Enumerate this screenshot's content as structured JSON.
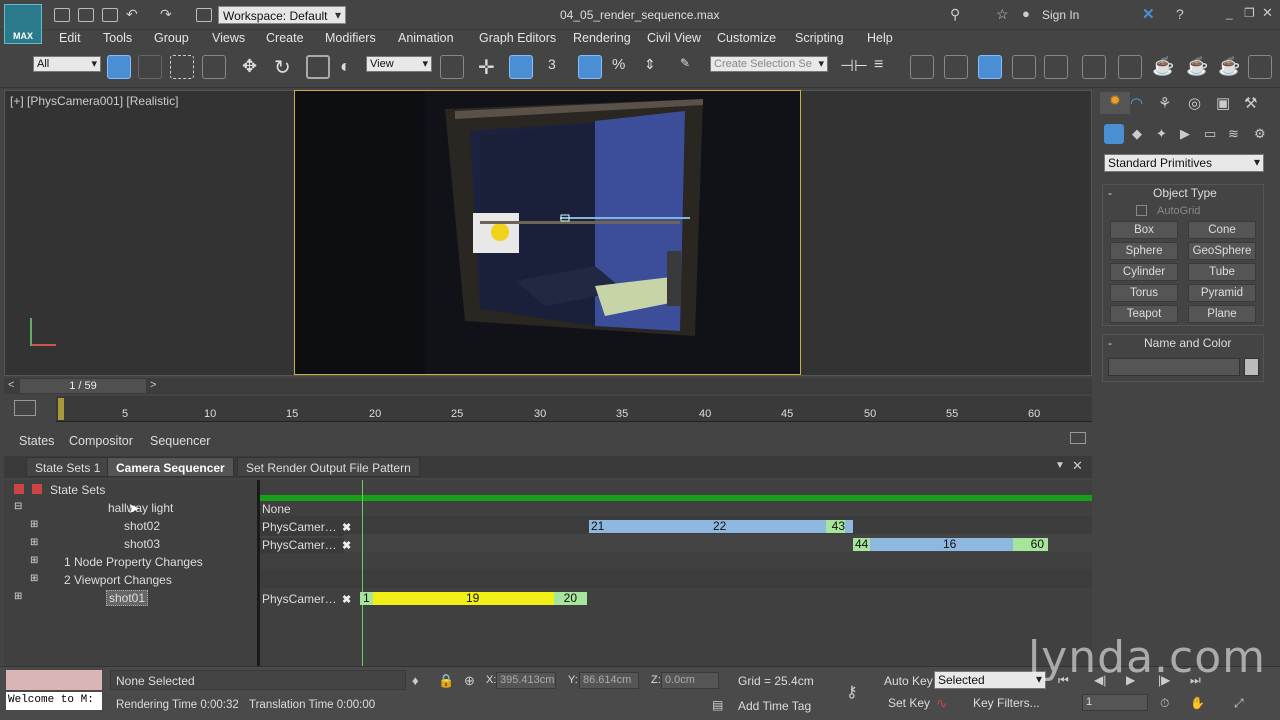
{
  "app": {
    "logo_label": "MAX",
    "workspace": "Workspace: Default",
    "file_title": "04_05_render_sequence.max",
    "sign_in": "Sign In"
  },
  "menu": [
    "Edit",
    "Tools",
    "Group",
    "Views",
    "Create",
    "Modifiers",
    "Animation",
    "Graph Editors",
    "Rendering",
    "Civil View",
    "Customize",
    "Scripting",
    "Help"
  ],
  "toolbar": {
    "filter": "All",
    "ref_coord": "View",
    "selection_set_placeholder": "Create Selection Se"
  },
  "viewport": {
    "label": "[+] [PhysCamera001] [Realistic]"
  },
  "timeline": {
    "frame": "1 / 59",
    "ticks": [
      "5",
      "10",
      "15",
      "20",
      "25",
      "30",
      "35",
      "40",
      "45",
      "50",
      "55",
      "60"
    ]
  },
  "panel": {
    "tabs": [
      "States",
      "Compositor",
      "Sequencer"
    ],
    "subtabs": [
      "State Sets 1",
      "Camera Sequencer",
      "Set Render Output File Pattern"
    ],
    "root": "State Sets",
    "rows": [
      {
        "label": "hallway light",
        "camera": "None"
      },
      {
        "label": "shot02",
        "camera": "PhysCamer…",
        "start": "21",
        "mid": "22",
        "end": "43"
      },
      {
        "label": "shot03",
        "camera": "PhysCamer…",
        "start": "44",
        "mid": "16",
        "end": "60"
      },
      {
        "label": "1 Node Property Changes"
      },
      {
        "label": "2 Viewport Changes"
      },
      {
        "label": "shot01",
        "camera": "PhysCamer…",
        "start": "1",
        "mid": "19",
        "end": "20"
      }
    ]
  },
  "command_panel": {
    "dropdown": "Standard Primitives",
    "object_type": "Object Type",
    "autogrid": "AutoGrid",
    "buttons": [
      "Box",
      "Cone",
      "Sphere",
      "GeoSphere",
      "Cylinder",
      "Tube",
      "Torus",
      "Pyramid",
      "Teapot",
      "Plane"
    ],
    "name_color": "Name and Color"
  },
  "status": {
    "welcome": "Welcome to M:",
    "none_selected": "None Selected",
    "rendering_time": "Rendering Time  0:00:32",
    "translation_time": "Translation Time  0:00:00",
    "x_label": "X:",
    "x": "395.413cm",
    "y_label": "Y:",
    "y": "86.614cm",
    "z_label": "Z:",
    "z": "0.0cm",
    "grid": "Grid = 25.4cm",
    "add_time_tag": "Add Time Tag",
    "auto_key": "Auto Key",
    "set_key": "Set Key",
    "selected": "Selected",
    "key_filters": "Key Filters...",
    "frame_field": "1"
  },
  "watermark": "lynda.com"
}
